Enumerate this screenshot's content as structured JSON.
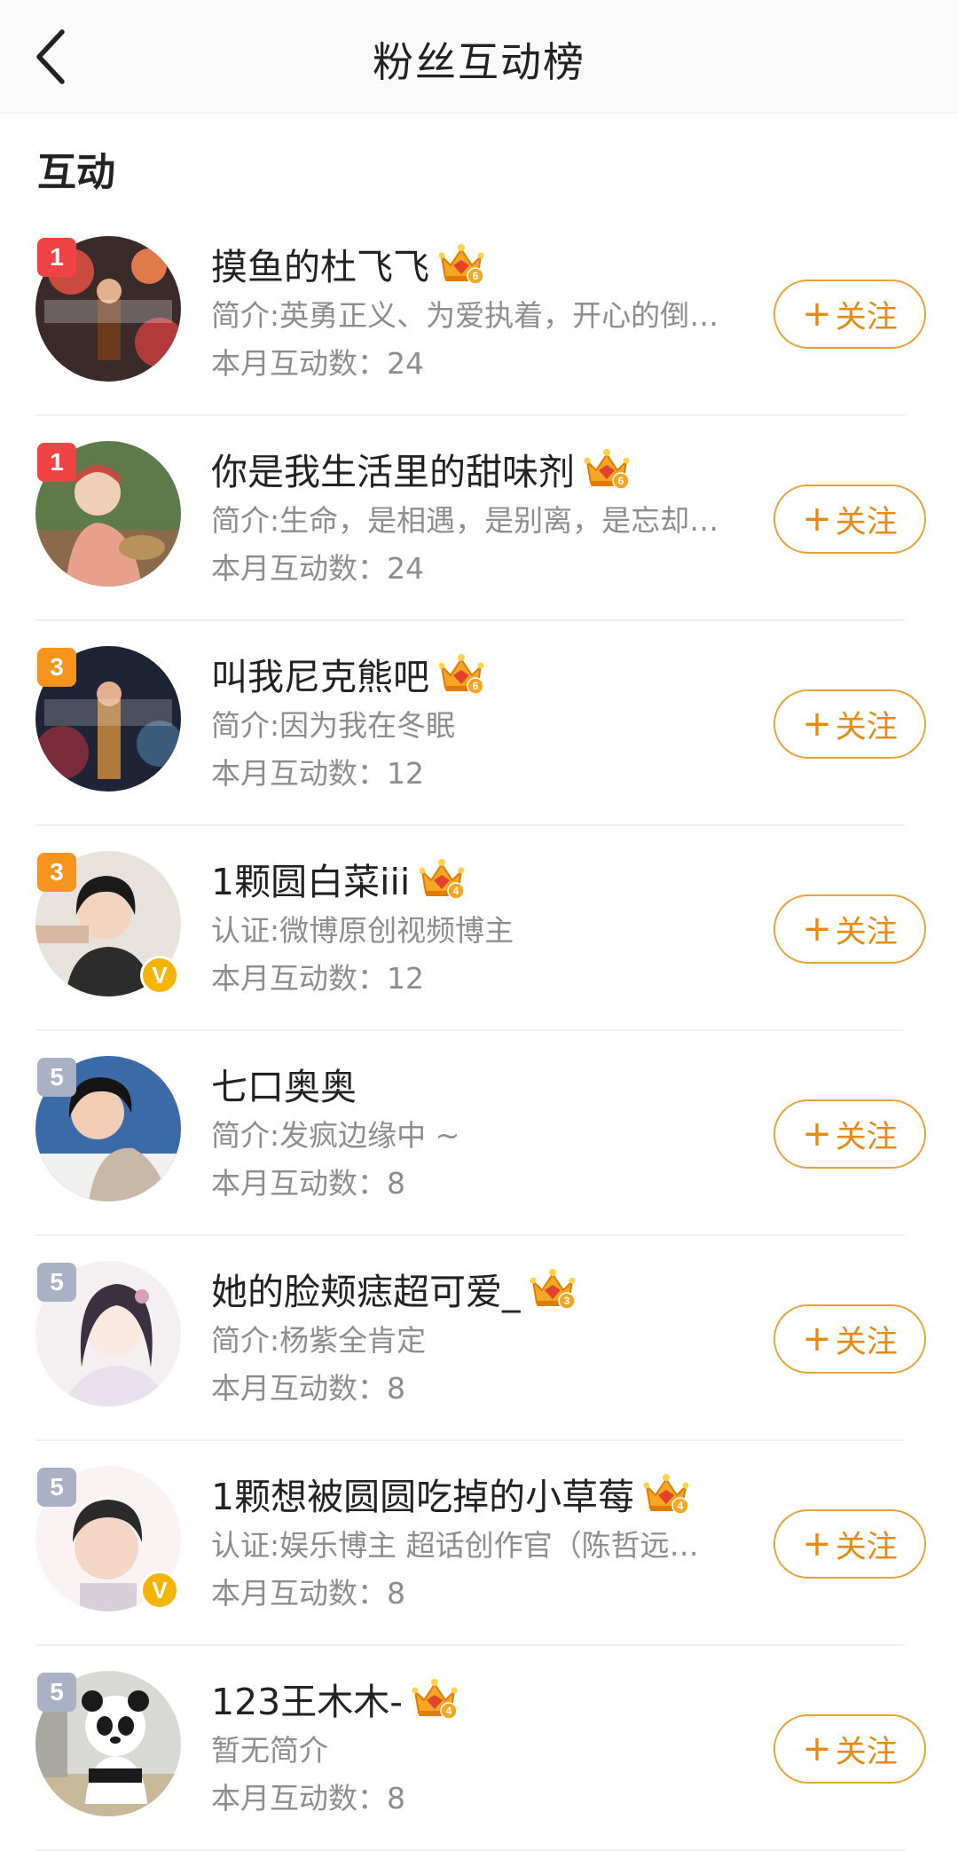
{
  "header": {
    "title": "粉丝互动榜"
  },
  "section": {
    "title": "互动"
  },
  "follow_label": "关注",
  "follow_plus": "+",
  "count_prefix": "本月互动数：",
  "colors": {
    "accent": "#e68a14",
    "rank_red": "#f04444",
    "rank_orange": "#f7941d",
    "rank_gray": "#aab1c4",
    "verified": "#f5b400"
  },
  "fans": [
    {
      "rank": "1",
      "rank_color": "rank_red",
      "name": "摸鱼的杜飞飞",
      "crown_level": "6",
      "bio": "简介:英勇正义、为爱执着，开心的倒…",
      "count": "24",
      "verified": false,
      "avatar": "poster-dark"
    },
    {
      "rank": "1",
      "rank_color": "rank_red",
      "name": "你是我生活里的甜味剂",
      "crown_level": "6",
      "bio": "简介:生命，是相遇，是别离，是忘却…",
      "count": "24",
      "verified": false,
      "avatar": "portrait-green"
    },
    {
      "rank": "3",
      "rank_color": "rank_orange",
      "name": "叫我尼克熊吧",
      "crown_level": "6",
      "bio": "简介:因为我在冬眠",
      "count": "12",
      "verified": false,
      "avatar": "poster-night"
    },
    {
      "rank": "3",
      "rank_color": "rank_orange",
      "name": "1颗圆白菜iii",
      "crown_level": "4",
      "bio": "认证:微博原创视频博主",
      "count": "12",
      "verified": true,
      "avatar": "portrait-dark-hair"
    },
    {
      "rank": "5",
      "rank_color": "rank_gray",
      "name": "七口奥奥",
      "crown_level": "",
      "bio": "简介:发疯边缘中 ~",
      "count": "8",
      "verified": false,
      "avatar": "portrait-blue"
    },
    {
      "rank": "5",
      "rank_color": "rank_gray",
      "name": "她的脸颊痣超可爱_",
      "crown_level": "3",
      "bio": "简介:杨紫全肯定",
      "count": "8",
      "verified": false,
      "avatar": "portrait-illustration"
    },
    {
      "rank": "5",
      "rank_color": "rank_gray",
      "name": "1颗想被圆圆吃掉的小草莓",
      "crown_level": "4",
      "bio": "认证:娱乐博主 超话创作官（陈哲远…",
      "count": "8",
      "verified": true,
      "avatar": "portrait-cute"
    },
    {
      "rank": "5",
      "rank_color": "rank_gray",
      "name": "123王木木-",
      "crown_level": "4",
      "bio": "暂无简介",
      "count": "8",
      "verified": false,
      "avatar": "panda"
    }
  ]
}
